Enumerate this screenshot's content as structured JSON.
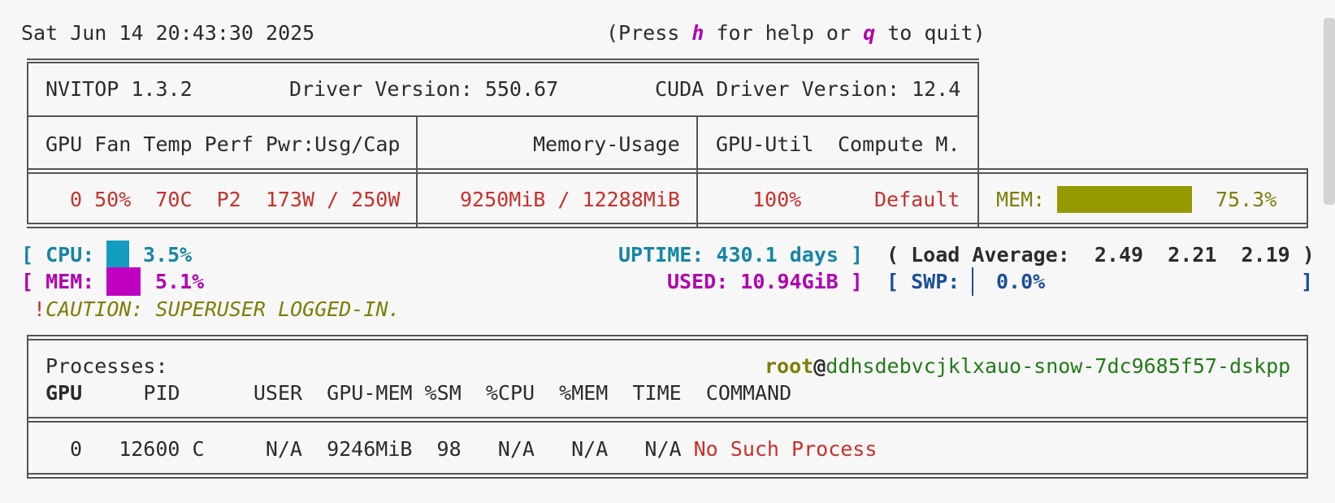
{
  "header": {
    "datetime": "Sat Jun 14 20:43:30 2025",
    "help_prefix": "(Press ",
    "help_key": "h",
    "help_mid": " for help or ",
    "quit_key": "q",
    "help_suffix": " to quit)"
  },
  "gpu_panel": {
    "nvitop_version": "NVITOP 1.3.2",
    "driver_version": "Driver Version: 550.67",
    "cuda_version": "CUDA Driver Version: 12.4",
    "headers": {
      "gpu_cols": "GPU Fan Temp Perf Pwr:Usg/Cap",
      "memory": "Memory-Usage",
      "util": "GPU-Util",
      "compute": "Compute M."
    },
    "row": {
      "gpu_stats": "0 50%  70C  P2  173W / 250W",
      "memory": "9250MiB / 12288MiB",
      "util": "100%",
      "compute": "Default",
      "mem_label": "MEM:",
      "mem_percent": "75.3%",
      "mem_fraction": 0.753
    }
  },
  "host": {
    "cpu_open": "[ CPU:",
    "cpu_percent": "3.5%",
    "cpu_fraction": 0.035,
    "uptime": "UPTIME: 430.1 days ]",
    "load_avg": "( Load Average:  2.49  2.21  2.19 )",
    "mem_open": "[ MEM:",
    "mem_percent": "5.1%",
    "mem_fraction": 0.051,
    "used": "USED: 10.94GiB ]",
    "swp_open": "[ SWP:",
    "swp_percent": "0.0%",
    "swp_close": "]",
    "caution_mark": "!",
    "caution_text": "CAUTION: SUPERUSER LOGGED-IN."
  },
  "processes": {
    "title": "Processes:",
    "user": "root",
    "at": "@",
    "hostname": "ddhsdebvcjklxauo-snow-7dc9685f57-dskpp",
    "columns": {
      "gpu": "GPU",
      "rest": "     PID      USER  GPU-MEM %SM  %CPU  %MEM  TIME  COMMAND"
    },
    "rows": [
      {
        "stats": "0   12600 C     N/A  9246MiB  98   N/A   N/A   N/A ",
        "command": "No Such Process"
      }
    ]
  },
  "colors": {
    "bar_cpu": "#149cc0",
    "bar_mem": "#c000c0",
    "bar_gpu_mem": "#949a00",
    "error_red": "#c8302a"
  }
}
